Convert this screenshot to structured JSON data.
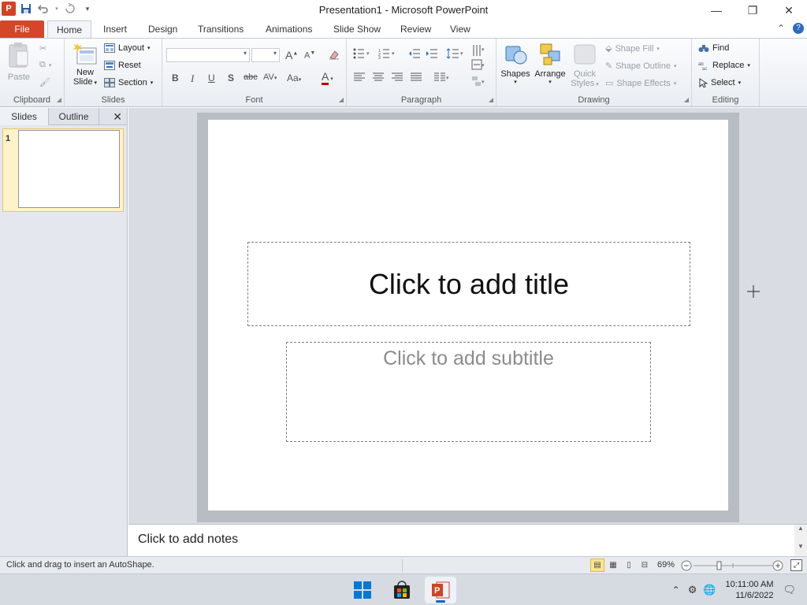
{
  "window": {
    "title": "Presentation1  -  Microsoft PowerPoint",
    "app_letter": "P",
    "controls": {
      "minimize": "—",
      "restore": "❐",
      "close": "✕"
    }
  },
  "tabs": [
    {
      "label": "File"
    },
    {
      "label": "Home"
    },
    {
      "label": "Insert"
    },
    {
      "label": "Design"
    },
    {
      "label": "Transitions"
    },
    {
      "label": "Animations"
    },
    {
      "label": "Slide Show"
    },
    {
      "label": "Review"
    },
    {
      "label": "View"
    }
  ],
  "ribbon": {
    "clipboard": {
      "label": "Clipboard",
      "paste": "Paste"
    },
    "slides": {
      "label": "Slides",
      "new_slide_1": "New",
      "new_slide_2": "Slide",
      "layout": "Layout",
      "reset": "Reset",
      "section": "Section"
    },
    "font": {
      "label": "Font",
      "bold": "B",
      "italic": "I",
      "underline": "U",
      "shadow": "S",
      "strike": "abc",
      "spacing": "AV",
      "case": "Aa",
      "color": "A",
      "grow": "A",
      "shrink": "A"
    },
    "paragraph": {
      "label": "Paragraph"
    },
    "drawing": {
      "label": "Drawing",
      "shapes": "Shapes",
      "arrange": "Arrange",
      "quick_styles_1": "Quick",
      "quick_styles_2": "Styles",
      "shape_fill": "Shape Fill",
      "shape_outline": "Shape Outline",
      "shape_effects": "Shape Effects"
    },
    "editing": {
      "label": "Editing",
      "find": "Find",
      "replace": "Replace",
      "select": "Select"
    }
  },
  "left_pane": {
    "tab_slides": "Slides",
    "tab_outline": "Outline",
    "close": "✕",
    "slide_number": "1"
  },
  "slide": {
    "title_placeholder": "Click to add title",
    "subtitle_placeholder": "Click to add subtitle"
  },
  "notes": {
    "placeholder": "Click to add notes"
  },
  "status": {
    "message": "Click and drag to insert an AutoShape.",
    "zoom": "69%"
  },
  "taskbar": {
    "time": "10:11:00 AM",
    "date": "11/6/2022"
  },
  "colors": {
    "file_tab": "#d4452a",
    "accent_blue": "#0067c0",
    "slide_bg": "#ffffff",
    "editor_bg": "#d9dde3"
  }
}
